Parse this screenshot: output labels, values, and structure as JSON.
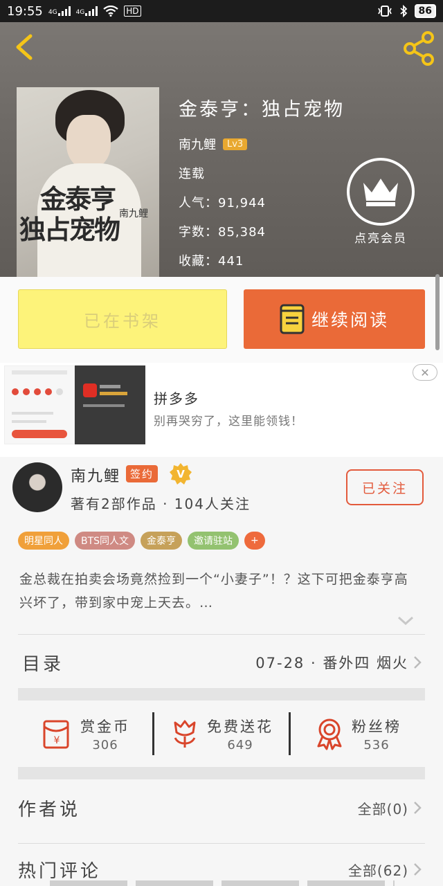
{
  "status_bar": {
    "time": "19:55",
    "net1": "4G",
    "net2": "4G",
    "hd": "HD",
    "battery": "86"
  },
  "book": {
    "title": "金泰亨：独占宠物",
    "author": "南九鲤",
    "level": "Lv3",
    "status": "连载",
    "popularity": "人气：91,944",
    "word_count": "字数：85,384",
    "favorites": "收藏：441",
    "cover_title_line1": "金泰亨",
    "cover_title_line2": "独占宠物",
    "cover_author": "南九鲤"
  },
  "member": {
    "label": "点亮会员"
  },
  "actions": {
    "shelf_label": "已在书架",
    "read_label": "继续阅读"
  },
  "ad": {
    "title": "拼多多",
    "description": "别再哭穷了，这里能领钱！",
    "close": "✕"
  },
  "author_card": {
    "name": "南九鲤",
    "signed_badge": "签约",
    "stats": "著有2部作品 · 104人关注",
    "follow_label": "已关注"
  },
  "tags": [
    {
      "label": "明星同人",
      "color": "#f0a03a"
    },
    {
      "label": "BTS同人文",
      "color": "#cf8a83"
    },
    {
      "label": "金泰亨",
      "color": "#c6a15a"
    },
    {
      "label": "邀请驻站",
      "color": "#93c270"
    },
    {
      "label": "+",
      "color": "#ee6a3c"
    }
  ],
  "synopsis": "金总裁在拍卖会场竟然捡到一个“小妻子”！？这下可把金泰亨高兴坏了，带到家中宠上天去。…",
  "toc": {
    "label": "目录",
    "latest": "07-28 · 番外四 烟火"
  },
  "rewards": [
    {
      "label": "赏金币",
      "value": "306",
      "icon": "red-envelope-icon"
    },
    {
      "label": "免费送花",
      "value": "649",
      "icon": "flower-icon"
    },
    {
      "label": "粉丝榜",
      "value": "536",
      "icon": "ribbon-medal-icon"
    }
  ],
  "author_says": {
    "title": "作者说",
    "all": "全部(0)"
  },
  "hot_comments": {
    "title": "热门评论",
    "all": "全部(62)"
  },
  "colors": {
    "accent": "#ea6a38",
    "shelf_button": "#fdf37a",
    "icon_red": "#d9452b",
    "back_yellow": "#f5c518"
  }
}
